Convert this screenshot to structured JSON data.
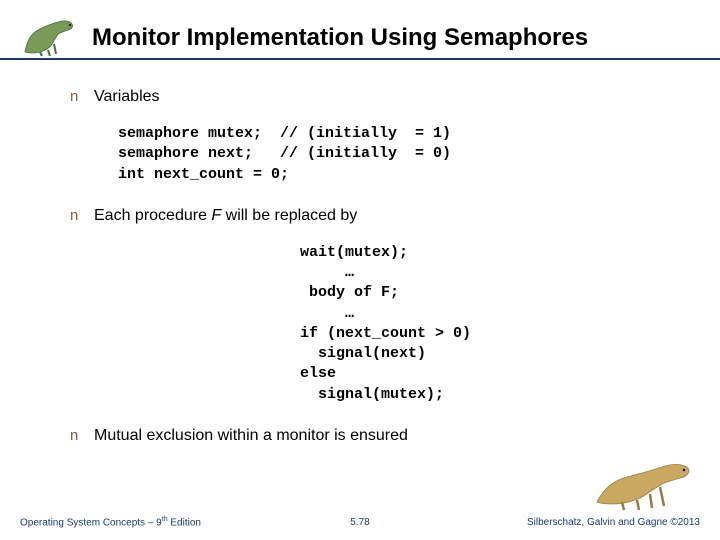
{
  "header": {
    "title": "Monitor Implementation Using Semaphores"
  },
  "bullets": {
    "b1": "Variables",
    "b2_pre": "Each procedure ",
    "b2_var": "F",
    "b2_post": "  will be replaced by",
    "b3": "Mutual exclusion within a monitor is ensured"
  },
  "code1": "semaphore mutex;  // (initially  = 1)\nsemaphore next;   // (initially  = 0)\nint next_count = 0;",
  "code2": "wait(mutex);\n     …\n body of F;\n     …\nif (next_count > 0)\n  signal(next)\nelse\n  signal(mutex);",
  "footer": {
    "left_pre": "Operating System Concepts – 9",
    "left_sup": "th",
    "left_post": " Edition",
    "center": "5.78",
    "right": "Silberschatz, Galvin and Gagne ©2013"
  }
}
